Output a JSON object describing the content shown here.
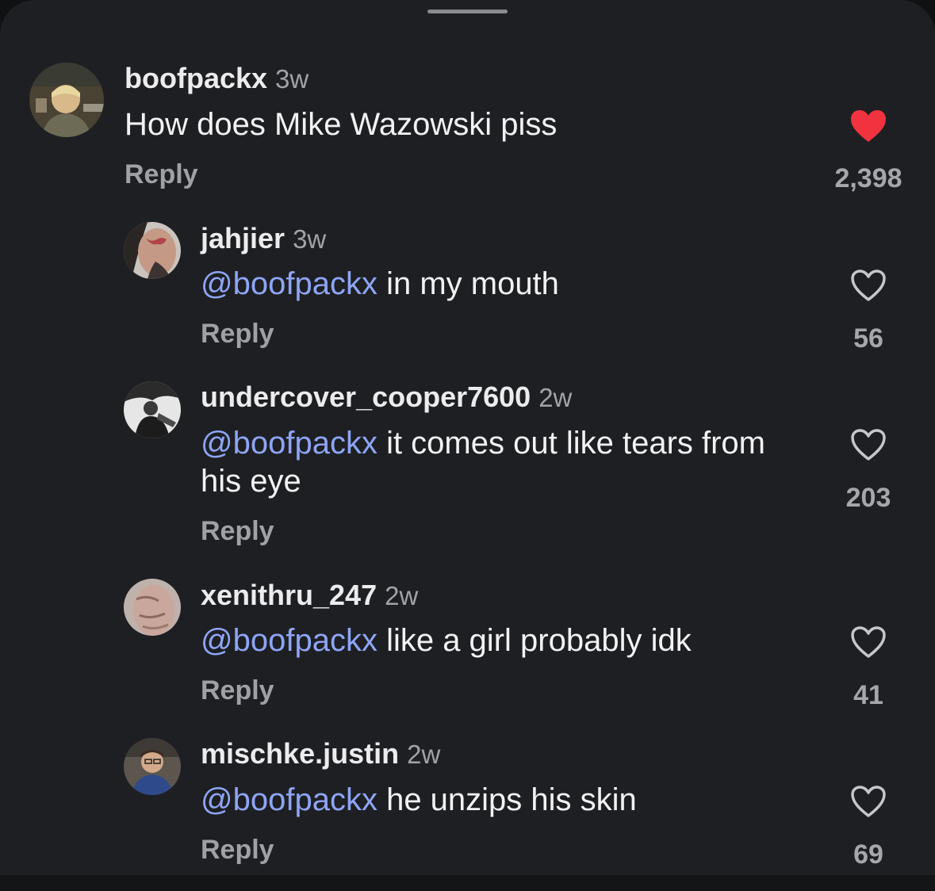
{
  "comments": [
    {
      "username": "boofpackx",
      "time": "3w",
      "mention": "",
      "text": "How does Mike Wazowski piss",
      "reply_label": "Reply",
      "likes": "2,398",
      "liked": true,
      "avatar_icon": "user-avatar"
    },
    {
      "username": "jahjier",
      "time": "3w",
      "mention": "@boofpackx",
      "text": " in my mouth",
      "reply_label": "Reply",
      "likes": "56",
      "liked": false,
      "avatar_icon": "user-avatar"
    },
    {
      "username": "undercover_cooper7600",
      "time": "2w",
      "mention": "@boofpackx",
      "text": " it comes out like tears from his eye",
      "reply_label": "Reply",
      "likes": "203",
      "liked": false,
      "avatar_icon": "user-avatar"
    },
    {
      "username": "xenithru_247",
      "time": "2w",
      "mention": "@boofpackx",
      "text": " like a girl probably idk",
      "reply_label": "Reply",
      "likes": "41",
      "liked": false,
      "avatar_icon": "user-avatar"
    },
    {
      "username": "mischke.justin",
      "time": "2w",
      "mention": "@boofpackx",
      "text": " he unzips his skin",
      "reply_label": "Reply",
      "likes": "69",
      "liked": false,
      "avatar_icon": "user-avatar"
    }
  ],
  "colors": {
    "background": "#1e1f22",
    "mention": "#8ea5f6",
    "liked_heart": "#f0333f",
    "secondary_text": "#a0a1a6"
  }
}
